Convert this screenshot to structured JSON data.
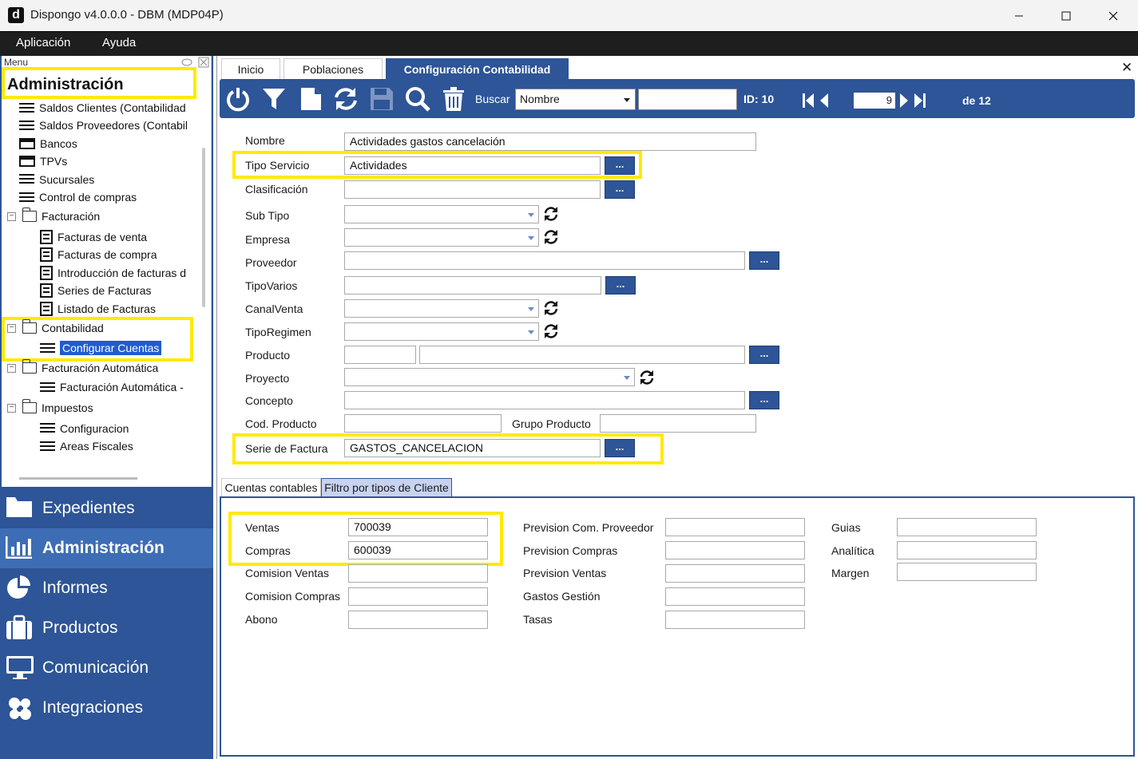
{
  "window": {
    "title": "Dispongo v4.0.0.0 - DBM (MDP04P)",
    "app_icon_letter": "d"
  },
  "menubar": {
    "items": [
      "Aplicación",
      "Ayuda"
    ]
  },
  "sidebar": {
    "caption": "Menu",
    "section_title": "Administración",
    "tree": [
      {
        "label": "Saldos Clientes (Contabilidad",
        "icon": "list-icon"
      },
      {
        "label": "Saldos Proveedores (Contabil",
        "icon": "list-icon"
      },
      {
        "label": "Bancos",
        "icon": "card-icon"
      },
      {
        "label": "TPVs",
        "icon": "card-icon"
      },
      {
        "label": "Sucursales",
        "icon": "list-icon"
      },
      {
        "label": "Control de compras",
        "icon": "list-icon"
      },
      {
        "label": "Facturación",
        "icon": "folder-icon"
      },
      {
        "label": "Facturas de venta",
        "icon": "document-icon"
      },
      {
        "label": "Facturas de compra",
        "icon": "document-icon"
      },
      {
        "label": "Introducción de facturas d",
        "icon": "document-icon"
      },
      {
        "label": "Series de Facturas",
        "icon": "document-icon"
      },
      {
        "label": "Listado de Facturas",
        "icon": "document-icon"
      },
      {
        "label": "Contabilidad",
        "icon": "folder-icon"
      },
      {
        "label": "Configurar Cuentas",
        "icon": "list-icon"
      },
      {
        "label": "Facturación Automática",
        "icon": "folder-icon"
      },
      {
        "label": "Facturación Automática -",
        "icon": "list-icon"
      },
      {
        "label": "Impuestos",
        "icon": "folder-icon"
      },
      {
        "label": "Configuracion",
        "icon": "list-icon"
      },
      {
        "label": "Areas Fiscales",
        "icon": "list-icon"
      }
    ],
    "nav": [
      {
        "label": "Expedientes",
        "icon": "folder-icon"
      },
      {
        "label": "Administración",
        "icon": "bar-chart-icon"
      },
      {
        "label": "Informes",
        "icon": "pie-chart-icon"
      },
      {
        "label": "Productos",
        "icon": "briefcase-icon"
      },
      {
        "label": "Comunicación",
        "icon": "monitor-icon"
      },
      {
        "label": "Integraciones",
        "icon": "puzzle-icon"
      }
    ]
  },
  "tabs": [
    "Inicio",
    "Poblaciones",
    "Configuración Contabilidad"
  ],
  "toolbar": {
    "buscar_label": "Buscar",
    "buscar_field": "Nombre",
    "buscar_value": "",
    "id_label": "ID: 10",
    "page": "9",
    "of_label": "de 12"
  },
  "form": {
    "nombre_label": "Nombre",
    "nombre_value": "Actividades gastos cancelación",
    "tipo_servicio_label": "Tipo Servicio",
    "tipo_servicio_value": "Actividades",
    "clasificacion_label": "Clasificación",
    "clasificacion_value": "",
    "sub_tipo_label": "Sub Tipo",
    "empresa_label": "Empresa",
    "proveedor_label": "Proveedor",
    "tipo_varios_label": "TipoVarios",
    "canal_venta_label": "CanalVenta",
    "tipo_regimen_label": "TipoRegimen",
    "producto_label": "Producto",
    "proyecto_label": "Proyecto",
    "concepto_label": "Concepto",
    "cod_producto_label": "Cod. Producto",
    "grupo_producto_label": "Grupo Producto",
    "serie_factura_label": "Serie de Factura",
    "serie_factura_value": "GASTOS_CANCELACION",
    "ellipsis": "..."
  },
  "subtabs": [
    "Cuentas contables",
    "Filtro por tipos de Cliente"
  ],
  "cuentas": {
    "ventas_label": "Ventas",
    "ventas_value": "700039",
    "compras_label": "Compras",
    "compras_value": "600039",
    "comision_ventas_label": "Comision Ventas",
    "comision_compras_label": "Comision Compras",
    "abono_label": "Abono",
    "prev_com_prov_label": "Prevision Com. Proveedor",
    "prev_compras_label": "Prevision Compras",
    "prev_ventas_label": "Prevision Ventas",
    "gastos_gestion_label": "Gastos Gestión",
    "tasas_label": "Tasas",
    "guias_label": "Guias",
    "analitica_label": "Analítica",
    "margen_label": "Margen"
  },
  "colors": {
    "accent": "#2d5597",
    "highlight": "#ffea00",
    "selection": "#1f5cce"
  }
}
